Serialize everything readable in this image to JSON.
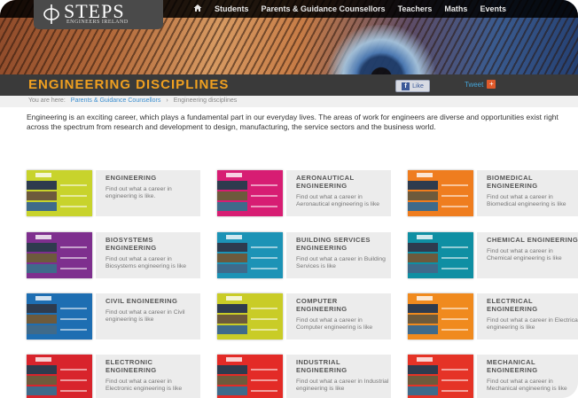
{
  "header": {
    "logo_name": "STEPS",
    "logo_subtitle": "ENGINEERS IRELAND",
    "nav": [
      {
        "label": "Students"
      },
      {
        "label": "Parents & Guidance Counsellors"
      },
      {
        "label": "Teachers"
      },
      {
        "label": "Maths"
      },
      {
        "label": "Events"
      }
    ]
  },
  "page": {
    "title": "ENGINEERING DISCIPLINES",
    "like_label": "Like",
    "tweet_label": "Tweet"
  },
  "breadcrumb": {
    "prefix": "You are here:",
    "items": [
      "Parents & Guidance Counsellors",
      "Engineering disciplines"
    ],
    "separator": "›"
  },
  "intro": "Engineering is an exciting career, which plays a fundamental part in our everyday lives. The areas of work for engineers are diverse and opportunities exist right across the spectrum from research and development to design, manufacturing, the service sectors and the business world.",
  "disciplines": [
    {
      "title": "ENGINEERING",
      "desc": "Find out what a career in engineering is like.",
      "color": "#c8d32c"
    },
    {
      "title": "AERONAUTICAL ENGINEERING",
      "desc": "Find out what a career in Aeronautical engineering is like",
      "color": "#d71d73"
    },
    {
      "title": "BIOMEDICAL ENGINEERING",
      "desc": "Find out what a career in Biomedical engineering is like",
      "color": "#ef7d1f"
    },
    {
      "title": "BIOSYSTEMS ENGINEERING",
      "desc": "Find out what a career in Biosystems engineering is like",
      "color": "#7e2f8e"
    },
    {
      "title": "BUILDING SERVICES ENGINEERING",
      "desc": "Find out what a career in Building Services is like",
      "color": "#1c93b6"
    },
    {
      "title": "CHEMICAL ENGINEERING",
      "desc": "Find out what a career in Chemical engineering is like",
      "color": "#0f8fa3"
    },
    {
      "title": "CIVIL ENGINEERING",
      "desc": "Find out what a career in Civil engineering is like",
      "color": "#1e6eb2"
    },
    {
      "title": "COMPUTER ENGINEERING",
      "desc": "Find out what a career in Computer engineering is like",
      "color": "#c9cc27"
    },
    {
      "title": "ELECTRICAL ENGINEERING",
      "desc": "Find out what a career in Electrical engineering is like",
      "color": "#f08a1e"
    },
    {
      "title": "ELECTRONIC ENGINEERING",
      "desc": "Find out what a career in Electronic engineering is like",
      "color": "#d8242c"
    },
    {
      "title": "INDUSTRIAL ENGINEERING",
      "desc": "Find out what a career in Industrial engineering is like",
      "color": "#e32b27"
    },
    {
      "title": "MECHANICAL ENGINEERING",
      "desc": "Find out what a career in Mechanical engineering is like",
      "color": "#e53326"
    }
  ]
}
